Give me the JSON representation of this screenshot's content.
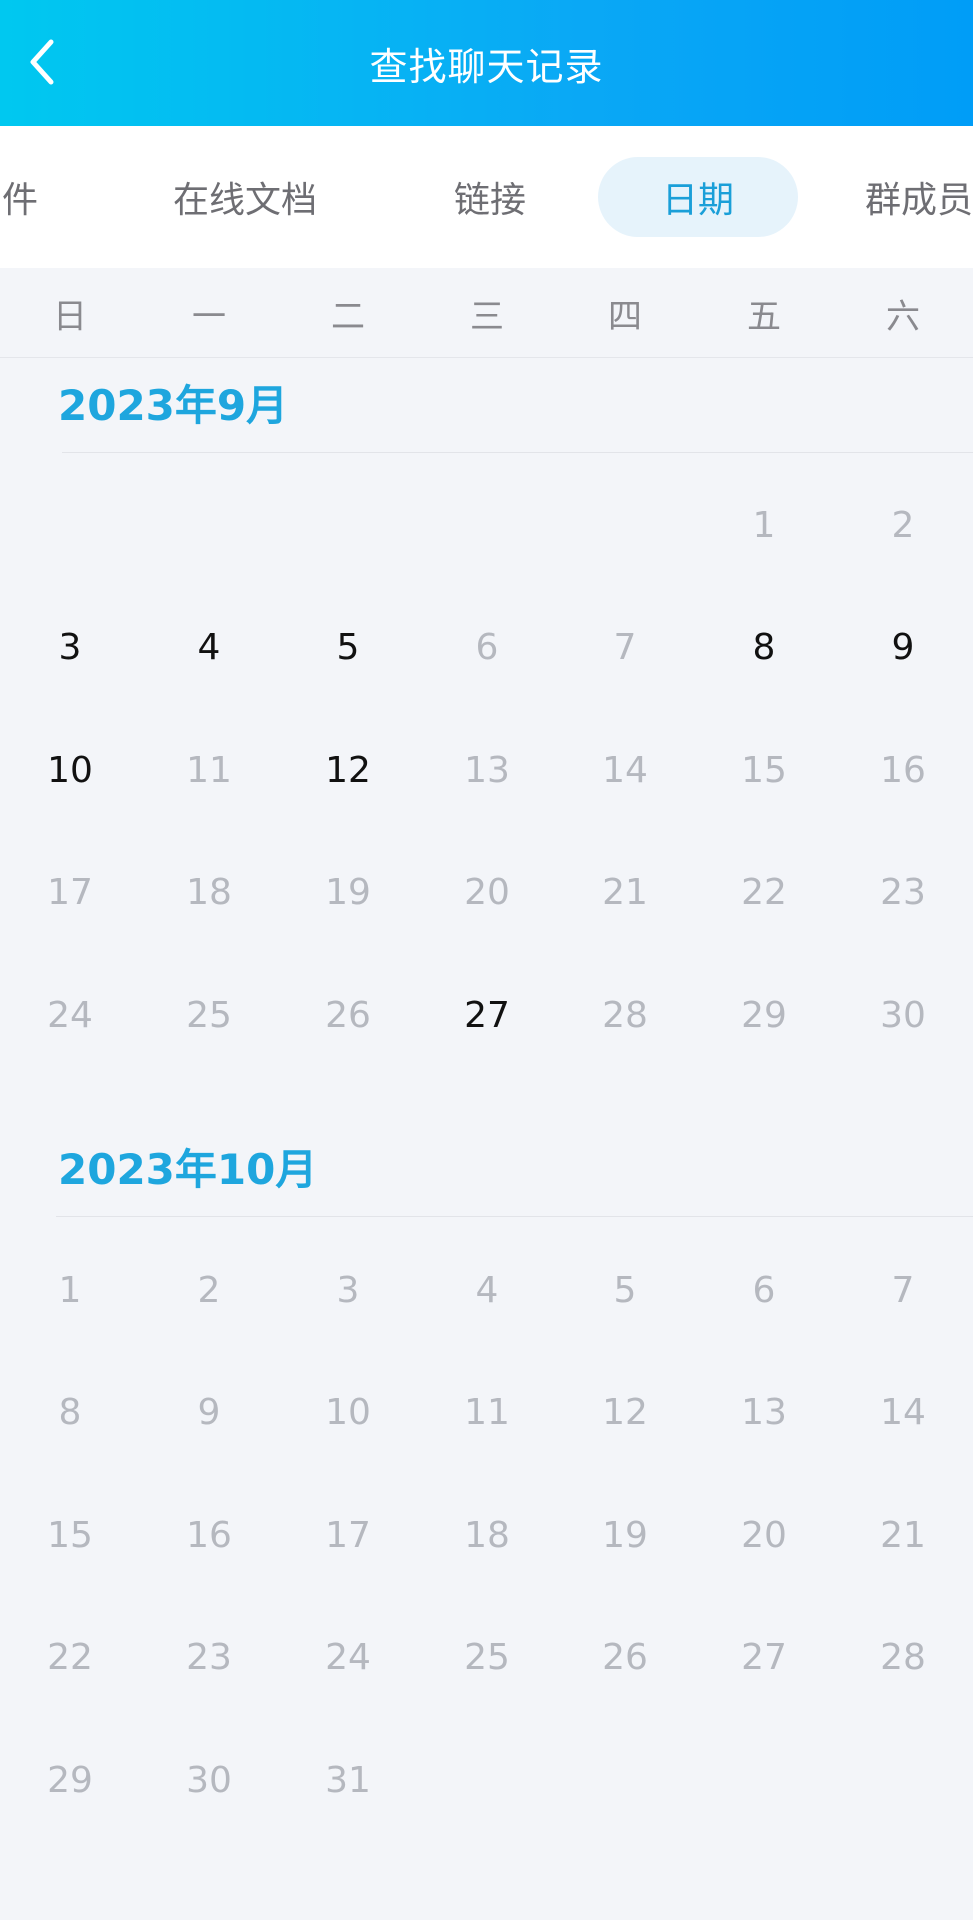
{
  "header": {
    "title": "查找聊天记录",
    "back_icon": "chevron-left-icon"
  },
  "tabs": [
    {
      "label": "件",
      "active": false
    },
    {
      "label": "在线文档",
      "active": false
    },
    {
      "label": "链接",
      "active": false
    },
    {
      "label": "日期",
      "active": true
    },
    {
      "label": "群成员",
      "active": false
    }
  ],
  "weekdays": [
    "日",
    "一",
    "二",
    "三",
    "四",
    "五",
    "六"
  ],
  "months": [
    {
      "title": "2023年9月",
      "first_weekday": 5,
      "days_in_month": 30,
      "active_days": [
        3,
        4,
        5,
        8,
        9,
        10,
        12,
        27
      ]
    },
    {
      "title": "2023年10月",
      "first_weekday": 0,
      "days_in_month": 31,
      "active_days": []
    }
  ],
  "colors": {
    "accent": "#1ea6de",
    "active_day": "#111111",
    "inactive_day": "#b5b8bf",
    "header_gradient_start": "#00c8f0",
    "header_gradient_end": "#009df7"
  }
}
